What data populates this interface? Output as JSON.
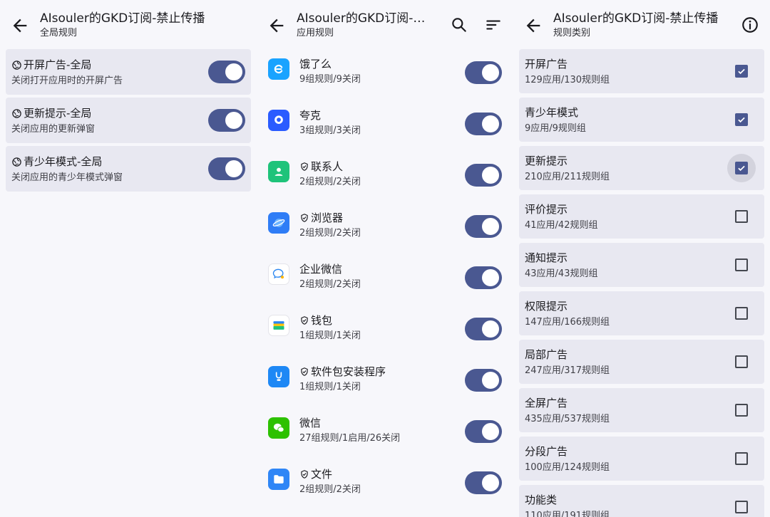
{
  "global_panel": {
    "title": "AIsouler的GKD订阅-禁止传播",
    "subtitle": "全局规则",
    "rules": [
      {
        "name": "开屏广告-全局",
        "desc": "关闭打开应用时的开屏广告",
        "enabled": true
      },
      {
        "name": "更新提示-全局",
        "desc": "关闭应用的更新弹窗",
        "enabled": true
      },
      {
        "name": "青少年模式-全局",
        "desc": "关闭应用的青少年模式弹窗",
        "enabled": true
      }
    ]
  },
  "apps_panel": {
    "title": "AIsouler的GKD订阅-禁…",
    "subtitle": "应用规则",
    "apps": [
      {
        "name": "饿了么",
        "stat": "9组规则/9关闭",
        "system": false,
        "icon": "eleme-icon",
        "color": "#1aa3ff",
        "enabled": true
      },
      {
        "name": "夸克",
        "stat": "3组规则/3关闭",
        "system": false,
        "icon": "quark-icon",
        "color": "#2a5bff",
        "enabled": true
      },
      {
        "name": "联系人",
        "stat": "2组规则/2关闭",
        "system": true,
        "icon": "contacts-icon",
        "color": "#1fc37a",
        "enabled": true
      },
      {
        "name": "浏览器",
        "stat": "2组规则/2关闭",
        "system": true,
        "icon": "browser-icon",
        "color": "#2f7df6",
        "enabled": true
      },
      {
        "name": "企业微信",
        "stat": "2组规则/2关闭",
        "system": false,
        "icon": "wecom-icon",
        "color": "#ffffff",
        "enabled": true
      },
      {
        "name": "钱包",
        "stat": "1组规则/1关闭",
        "system": true,
        "icon": "wallet-icon",
        "color": "#ffffff",
        "enabled": true
      },
      {
        "name": "软件包安装程序",
        "stat": "1组规则/1关闭",
        "system": true,
        "icon": "installer-icon",
        "color": "#1e88f5",
        "enabled": true
      },
      {
        "name": "微信",
        "stat": "27组规则/1启用/26关闭",
        "system": false,
        "icon": "wechat-icon",
        "color": "#2dc100",
        "enabled": true
      },
      {
        "name": "文件",
        "stat": "2组规则/2关闭",
        "system": true,
        "icon": "files-icon",
        "color": "#2f86f6",
        "enabled": true
      }
    ]
  },
  "categories_panel": {
    "title": "AIsouler的GKD订阅-禁止传播",
    "subtitle": "规则类别",
    "categories": [
      {
        "name": "开屏广告",
        "stat": "129应用/130规则组",
        "checked": true,
        "focused": false
      },
      {
        "name": "青少年模式",
        "stat": "9应用/9规则组",
        "checked": true,
        "focused": false
      },
      {
        "name": "更新提示",
        "stat": "210应用/211规则组",
        "checked": true,
        "focused": true
      },
      {
        "name": "评价提示",
        "stat": "41应用/42规则组",
        "checked": false,
        "focused": false
      },
      {
        "name": "通知提示",
        "stat": "43应用/43规则组",
        "checked": false,
        "focused": false
      },
      {
        "name": "权限提示",
        "stat": "147应用/166规则组",
        "checked": false,
        "focused": false
      },
      {
        "name": "局部广告",
        "stat": "247应用/317规则组",
        "checked": false,
        "focused": false
      },
      {
        "name": "全屏广告",
        "stat": "435应用/537规则组",
        "checked": false,
        "focused": false
      },
      {
        "name": "分段广告",
        "stat": "100应用/124规则组",
        "checked": false,
        "focused": false
      },
      {
        "name": "功能类",
        "stat": "110应用/191规则组",
        "checked": false,
        "focused": false
      }
    ]
  },
  "colors": {
    "accent": "#4a5891",
    "card": "#e8e8f1",
    "background": "#f7f7fb"
  }
}
